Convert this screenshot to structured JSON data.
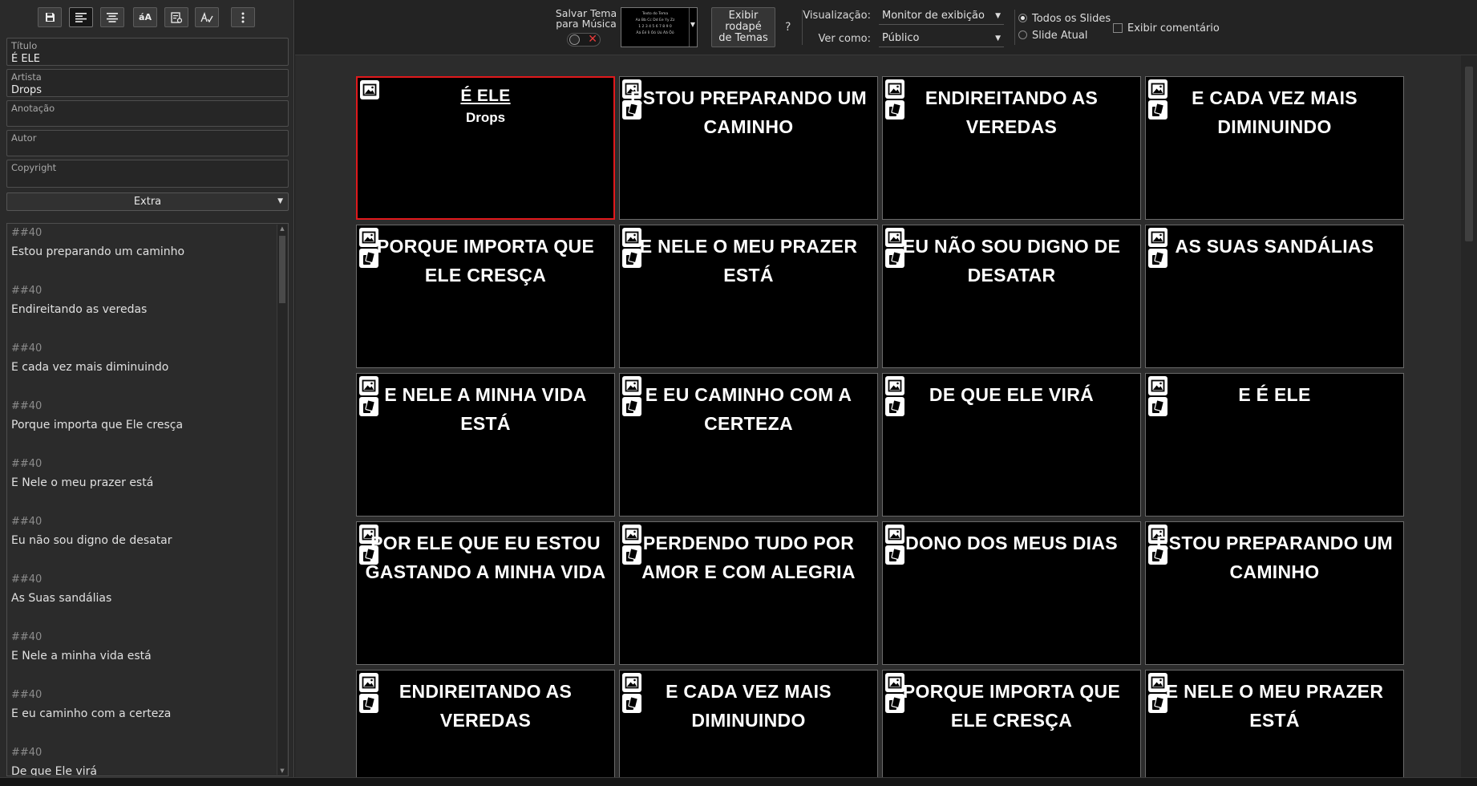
{
  "toolbar": {
    "icons": [
      "save-icon",
      "align-left-icon",
      "align-center-icon",
      "text-case-icon",
      "lyrics-format-icon",
      "spell-check-icon",
      "more-vertical-icon"
    ]
  },
  "fields": {
    "title": {
      "label": "Título",
      "value": "É ELE"
    },
    "artist": {
      "label": "Artista",
      "value": "Drops"
    },
    "annotation": {
      "label": "Anotação",
      "value": ""
    },
    "author": {
      "label": "Autor",
      "value": ""
    },
    "copyright": {
      "label": "Copyright",
      "value": ""
    }
  },
  "extra": {
    "label": "Extra"
  },
  "lyrics": [
    {
      "tag": "##40",
      "text": "Estou preparando um caminho"
    },
    {
      "tag": "##40",
      "text": "Endireitando as veredas"
    },
    {
      "tag": "##40",
      "text": "E cada vez mais diminuindo"
    },
    {
      "tag": "##40",
      "text": "Porque importa que Ele cresça"
    },
    {
      "tag": "##40",
      "text": "E Nele o meu prazer está"
    },
    {
      "tag": "##40",
      "text": "Eu não sou digno de desatar"
    },
    {
      "tag": "##40",
      "text": "As Suas sandálias"
    },
    {
      "tag": "##40",
      "text": "E Nele a minha vida está"
    },
    {
      "tag": "##40",
      "text": "E eu caminho com a certeza"
    },
    {
      "tag": "##40",
      "text": "De que Ele virá"
    }
  ],
  "topbar": {
    "theme_save_label_1": "Salvar Tema",
    "theme_save_label_2": "para Música",
    "theme_preview_lines": [
      "Texto do Tema",
      "Aa Bb Cc Dd Ee Yy Zz",
      "1 2 3 4 5 6 7 8 9 0",
      "Áá Éé Íí Óó Úú Ãã Õõ"
    ],
    "footer_btn_lines": [
      "Exibir",
      "rodapé",
      "de Temas"
    ],
    "help": "?",
    "view_label": "Visualização:",
    "view_value": "Monitor de exibição",
    "see_as_label": "Ver como:",
    "see_as_value": "Público",
    "radio_all": "Todos os Slides",
    "radio_current": "Slide Atual",
    "show_comment": "Exibir comentário"
  },
  "slides": [
    {
      "text": "É ELE",
      "sub": "Drops",
      "selected": true
    },
    {
      "text": "ESTOU PREPARANDO UM CAMINHO"
    },
    {
      "text": "ENDIREITANDO AS VEREDAS"
    },
    {
      "text": "E CADA VEZ MAIS DIMINUINDO"
    },
    {
      "text": "PORQUE IMPORTA QUE ELE CRESÇA"
    },
    {
      "text": "E NELE O MEU PRAZER ESTÁ"
    },
    {
      "text": "EU NÃO SOU DIGNO DE DESATAR"
    },
    {
      "text": "AS SUAS SANDÁLIAS"
    },
    {
      "text": "E NELE A MINHA VIDA ESTÁ"
    },
    {
      "text": "E EU CAMINHO COM A CERTEZA"
    },
    {
      "text": "DE QUE ELE VIRÁ"
    },
    {
      "text": "E É ELE"
    },
    {
      "text": "POR ELE QUE EU ESTOU GASTANDO A MINHA VIDA"
    },
    {
      "text": "PERDENDO TUDO POR AMOR E COM ALEGRIA"
    },
    {
      "text": "DONO DOS MEUS DIAS"
    },
    {
      "text": "ESTOU PREPARANDO UM CAMINHO"
    },
    {
      "text": "ENDIREITANDO AS VEREDAS"
    },
    {
      "text": "E CADA VEZ MAIS DIMINUINDO"
    },
    {
      "text": "PORQUE IMPORTA QUE ELE CRESÇA"
    },
    {
      "text": "E NELE O MEU PRAZER ESTÁ"
    }
  ],
  "colors": {
    "selected_border": "#e0191c",
    "slide_bg": "#000000",
    "slide_text": "#ffffff"
  }
}
